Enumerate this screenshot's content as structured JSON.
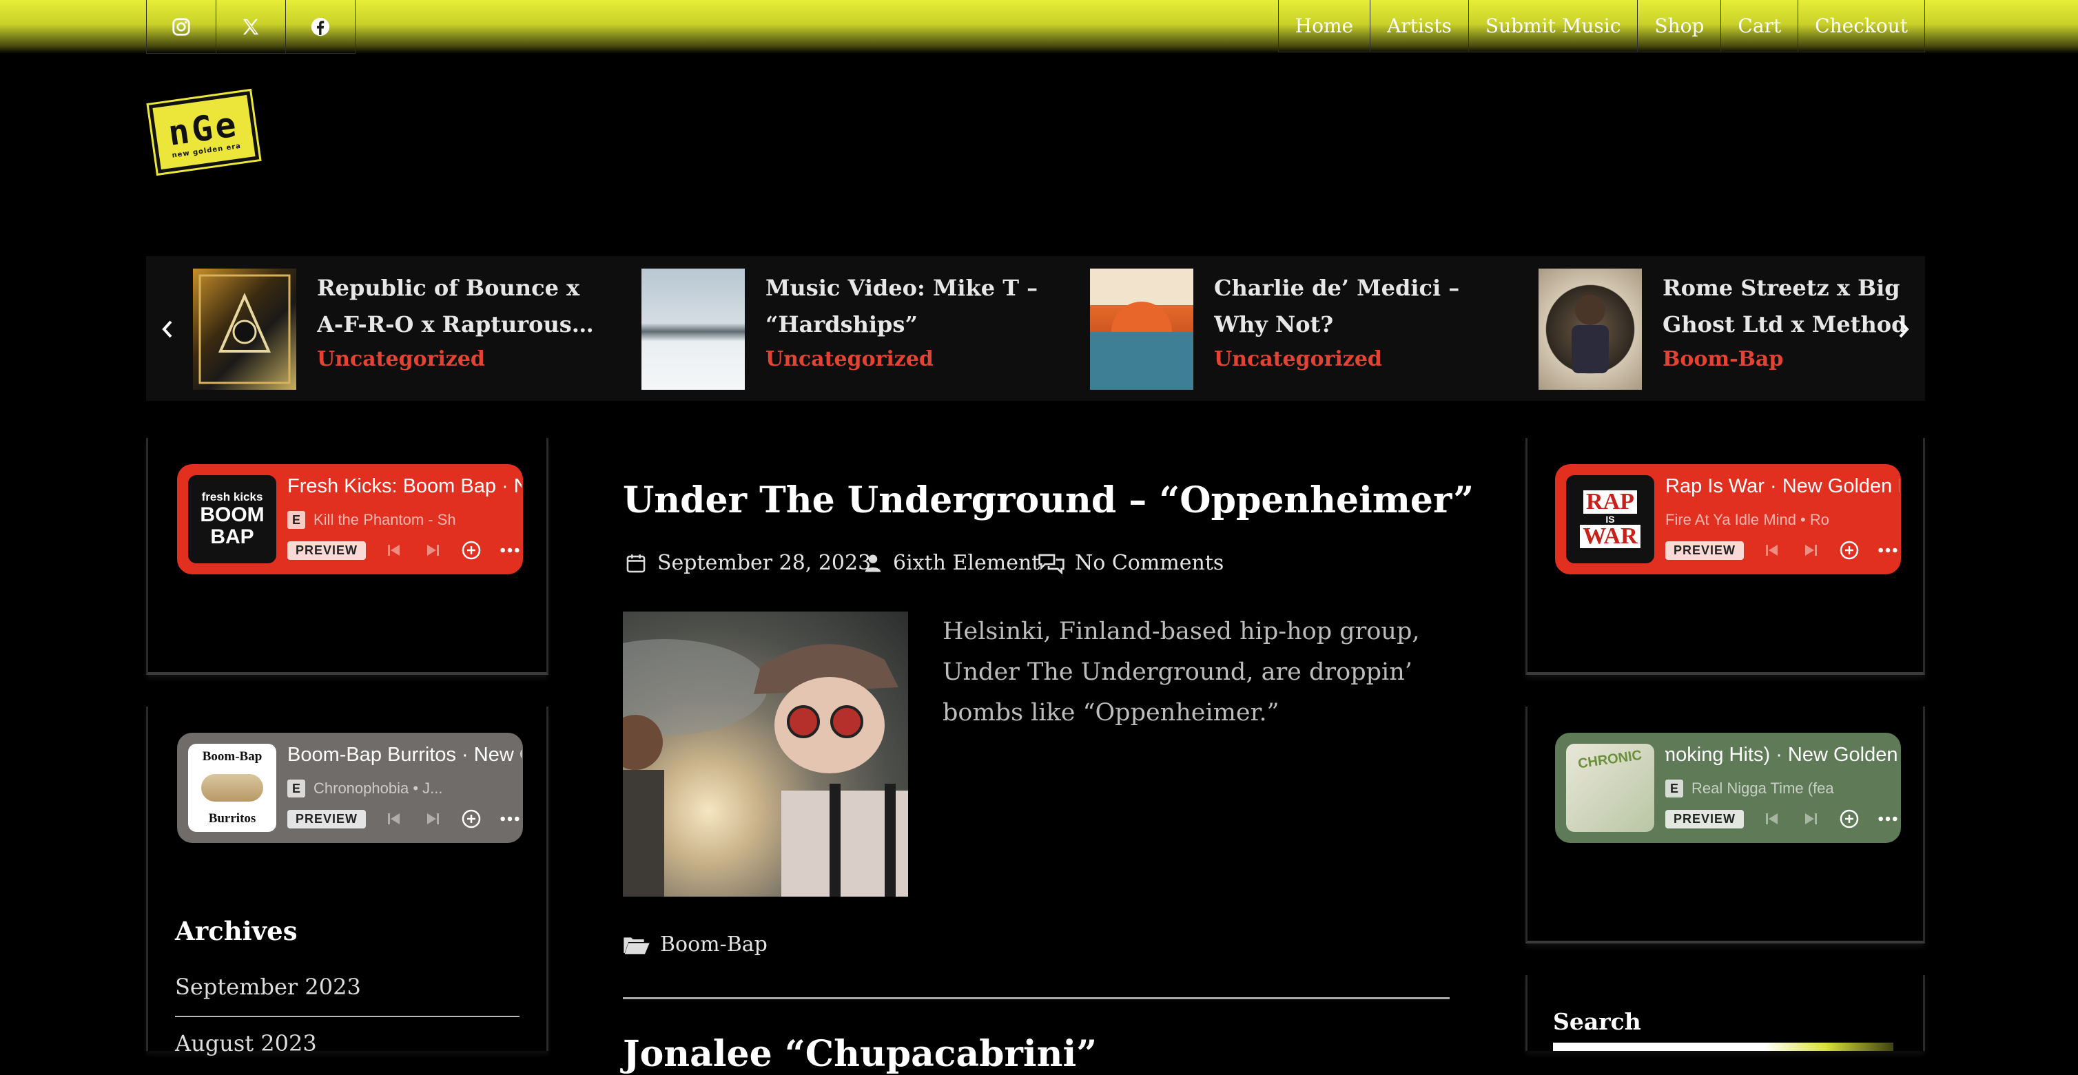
{
  "social": [
    {
      "name": "instagram-icon"
    },
    {
      "name": "x-icon"
    },
    {
      "name": "facebook-icon"
    }
  ],
  "nav": [
    "Home",
    "Artists",
    "Submit Music",
    "Shop",
    "Cart",
    "Checkout"
  ],
  "logo": {
    "main": "nGe",
    "sub": "new golden era"
  },
  "carousel": [
    {
      "title": "Republic of Bounce x A-F-R-O x Rapturous…",
      "category": "Uncategorized"
    },
    {
      "title": "Music Video: Mike T – “Hardships”",
      "category": "Uncategorized"
    },
    {
      "title": "Charlie de’ Medici – Why Not?",
      "category": "Uncategorized"
    },
    {
      "title": "Rome Streetz x Big Ghost Ltd x Method Man – “P…",
      "category": "Boom-Bap"
    }
  ],
  "players": {
    "left1": {
      "title": "Fresh Kicks: Boom Bap · New Golden Era",
      "track": "Kill the Phantom - Sh",
      "explicit": "E",
      "preview": "PREVIEW",
      "art_lines": [
        "fresh kicks",
        "BOOM",
        "BAP"
      ],
      "bg": "#e1301f"
    },
    "left2": {
      "title": "Boom-Bap Burritos · New Golden Era",
      "track": "Chronophobia  •  J...",
      "explicit": "E",
      "preview": "PREVIEW",
      "art_lines": [
        "Boom-Bap",
        "Burritos"
      ],
      "bg": "#6f6c6a"
    },
    "right1": {
      "title": "Rap Is War · New Golden Era",
      "track": "Fire At Ya Idle Mind  •  Ro",
      "preview": "PREVIEW",
      "art_lines": [
        "RAP",
        "IS",
        "WAR"
      ],
      "bg": "#e1301f"
    },
    "right2": {
      "title": "(Smoking Hits) · New Golden Era",
      "track": "Real Nigga Time (fea",
      "explicit": "E",
      "preview": "PREVIEW",
      "art_lines": [
        "CHRONIC"
      ],
      "bg": "#5f7a57"
    }
  },
  "archives": {
    "title": "Archives",
    "items": [
      "September 2023",
      "August 2023"
    ]
  },
  "post": {
    "title": "Under The Underground – “Oppenheimer”",
    "date": "September 28, 2023",
    "author": "6ixth Element",
    "comments": "No Comments",
    "excerpt": "Helsinki, Finland-based hip-hop group, Under The Underground, are droppin’ bombs like “Oppenheimer.”",
    "category": "Boom-Bap"
  },
  "next_post": {
    "title": "Jonalee “Chupacabrini”"
  },
  "search": {
    "title": "Search"
  },
  "colors": {
    "accent": "#e1ea3a",
    "category": "#e24333"
  }
}
